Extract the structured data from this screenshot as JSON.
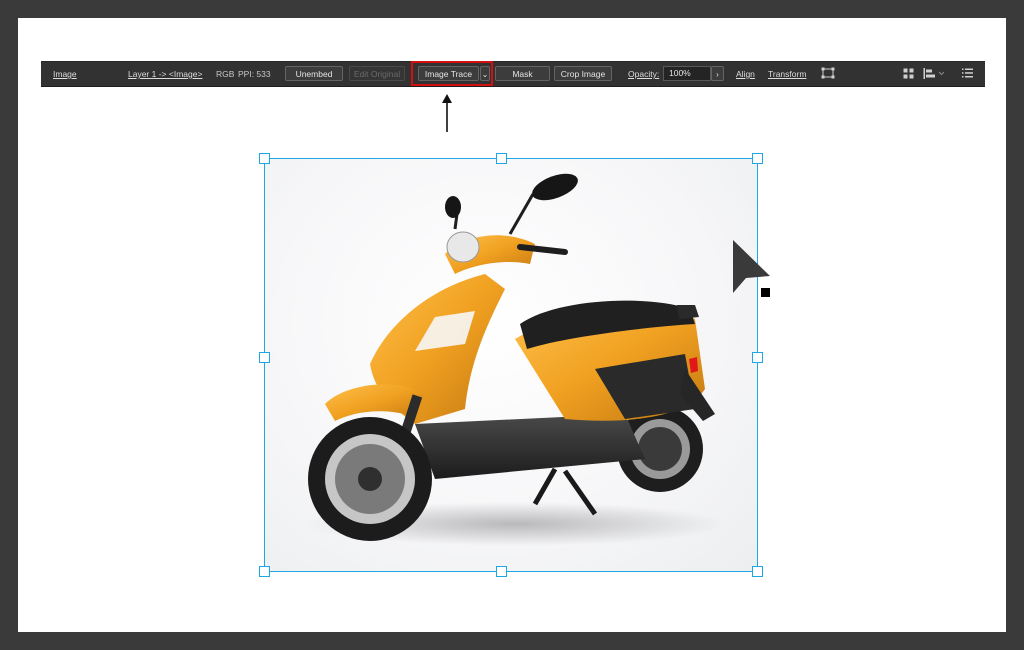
{
  "control_bar": {
    "object_type": "Image",
    "layer_path": "Layer 1 -> <Image>",
    "color_mode": "RGB",
    "ppi_text": "PPI: 533",
    "unembed_label": "Unembed",
    "edit_original_label": "Edit Original",
    "image_trace_label": "Image Trace",
    "mask_label": "Mask",
    "crop_image_label": "Crop Image",
    "opacity_label": "Opacity:",
    "opacity_value": "100%",
    "align_label": "Align",
    "transform_label": "Transform"
  },
  "icons": {
    "image_trace_dropdown": "chevron-down-icon",
    "opacity_arrow": "chevron-right-icon",
    "transform_bounds": "bounding-box-icon",
    "isolate": "isolate-icon",
    "align_options": "align-options-icon",
    "panel_menu": "menu-list-icon",
    "annotation_arrow": "up-arrow-icon",
    "cursor": "selection-cursor-icon"
  },
  "colors": {
    "workspace_bg": "#3a3a3a",
    "control_bar_bg": "#323232",
    "selection": "#1fa6e4",
    "highlight": "#d21010",
    "scooter_body": "#f0a020"
  }
}
